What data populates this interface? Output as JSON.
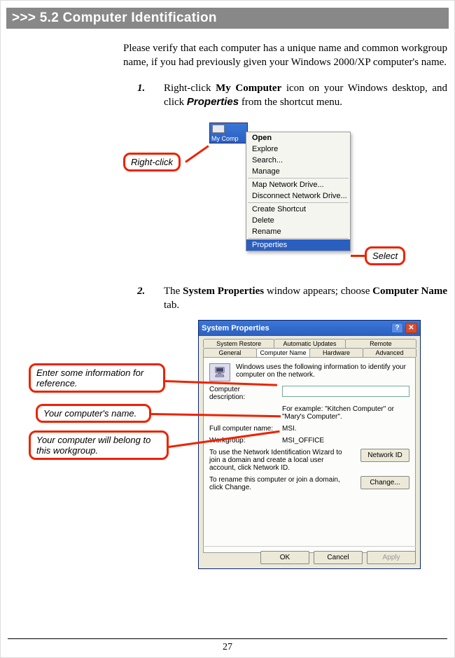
{
  "section_header": ">>> 5.2  Computer Identification",
  "intro": "Please verify that each computer has a unique name and common workgroup name, if you had previously given your Windows 2000/XP computer's name.",
  "steps": [
    {
      "num": "1.",
      "pre": "Right-click ",
      "bold1": "My Computer",
      "mid": " icon on your Windows desktop, and click ",
      "bolditalic": "Properties",
      "post": " from the shortcut menu."
    },
    {
      "num": "2.",
      "pre": "The ",
      "bold1": "System Properties",
      "mid": " window appears; choose ",
      "bold2": "Computer Name",
      "post": " tab."
    }
  ],
  "fig1": {
    "my_computer_label": "My Comp",
    "context_menu": [
      "Open",
      "Explore",
      "Search...",
      "Manage",
      "—",
      "Map Network Drive...",
      "Disconnect Network Drive...",
      "—",
      "Create Shortcut",
      "Delete",
      "Rename",
      "—",
      "Properties"
    ],
    "callout_right_click": "Right-click",
    "callout_select": "Select"
  },
  "fig2": {
    "title": "System Properties",
    "tabs_row1": [
      "System Restore",
      "Automatic Updates",
      "Remote"
    ],
    "tabs_row2": [
      "General",
      "Computer Name",
      "Hardware",
      "Advanced"
    ],
    "info_text": "Windows uses the following information to identify your computer on the network.",
    "desc_label": "Computer description:",
    "desc_example": "For example: \"Kitchen Computer\" or \"Mary's Computer\".",
    "fullname_label": "Full computer name:",
    "fullname_value": "MSI.",
    "workgroup_label": "Workgroup:",
    "workgroup_value": "MSI_OFFICE",
    "netid_text": "To use the Network Identification Wizard to join a domain and create a local user account, click Network ID.",
    "netid_btn": "Network ID",
    "change_text": "To rename this computer or join a domain, click Change.",
    "change_btn": "Change...",
    "ok_btn": "OK",
    "cancel_btn": "Cancel",
    "apply_btn": "Apply",
    "callout1": "Enter some information for reference.",
    "callout2": "Your computer's name.",
    "callout3": "Your computer will belong to this workgroup."
  },
  "page_number": "27"
}
